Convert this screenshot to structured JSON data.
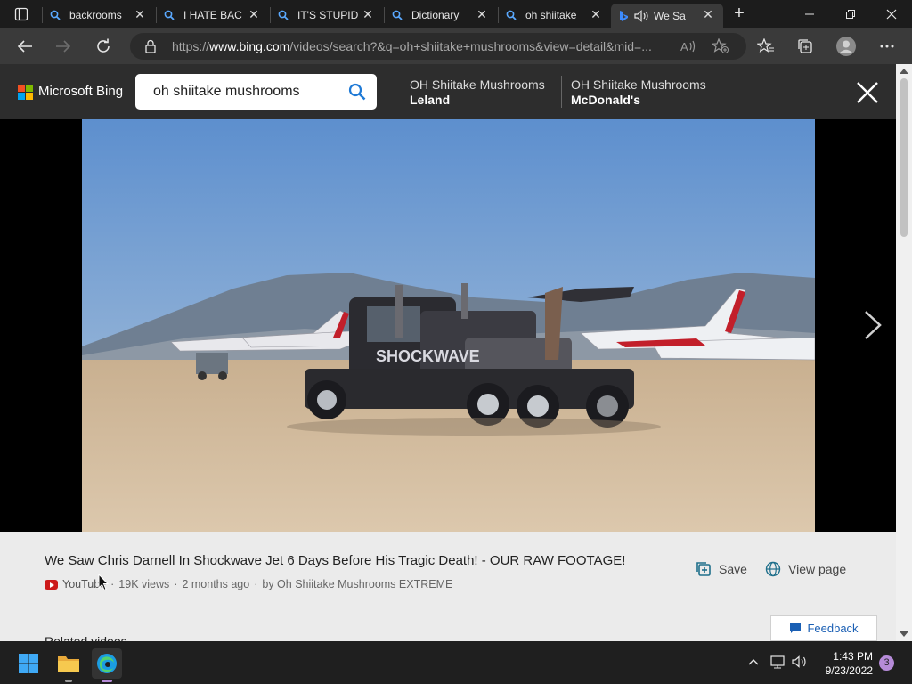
{
  "browser": {
    "tabs": [
      {
        "title": "backrooms",
        "icon": "search-icon"
      },
      {
        "title": "I HATE BAC",
        "icon": "search-icon"
      },
      {
        "title": "IT'S STUPID",
        "icon": "search-icon"
      },
      {
        "title": "Dictionary",
        "icon": "search-icon"
      },
      {
        "title": "oh shiitake",
        "icon": "search-icon"
      },
      {
        "title": "We Sa",
        "icon": "bing-icon",
        "active": true
      }
    ],
    "address": {
      "prefix": "https://",
      "host": "www.bing.com",
      "path": "/videos/search?&q=oh+shiitake+mushrooms&view=detail&mid=..."
    }
  },
  "bing": {
    "brand": "Microsoft Bing",
    "search_value": "oh shiitake mushrooms",
    "suggestions": [
      {
        "line1": "OH Shiitake Mushrooms",
        "line2": "Leland"
      },
      {
        "line1": "OH Shiitake Mushrooms",
        "line2": "McDonald's"
      }
    ]
  },
  "video": {
    "title": "We Saw Chris Darnell In Shockwave Jet 6 Days Before His Tragic Death! - OUR RAW FOOTAGE!",
    "source": "YouTube",
    "views": "19K views",
    "age": "2 months ago",
    "channel": "by Oh Shiitake Mushrooms EXTREME",
    "sep": "·",
    "save_label": "Save",
    "view_page_label": "View page",
    "related_label": "Related videos",
    "feedback_label": "Feedback"
  },
  "taskbar": {
    "time": "1:43 PM",
    "date": "9/23/2022",
    "notifications": "3"
  },
  "colors": {
    "bing_bar": "#2d2d2d",
    "accent_blue": "#1a5fb4",
    "youtube_red": "#cc1a1a"
  }
}
